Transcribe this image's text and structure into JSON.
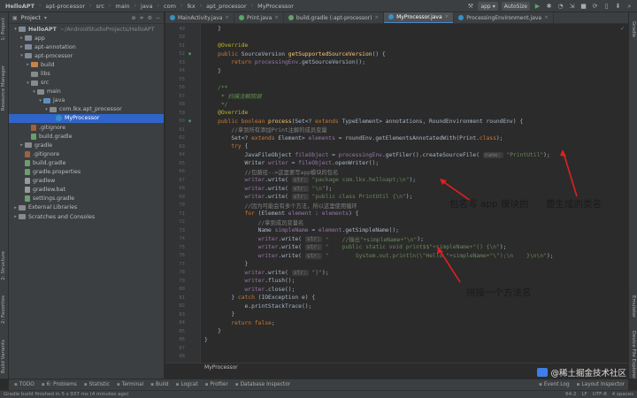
{
  "topbar": {
    "crumbs": [
      "HelloAPT",
      "apt-processor",
      "src",
      "main",
      "java",
      "com",
      "lkx",
      "apt_processor",
      "MyProcessor"
    ],
    "run_config": "app",
    "sync": "AutoSize"
  },
  "left_strip": {
    "labels": [
      "1: Project",
      "Resource Manager",
      "2: Structure",
      "2: Favorites",
      "Build Variants"
    ]
  },
  "right_strip": {
    "labels": [
      "Gradle",
      "Emulator",
      "Device File Explorer"
    ]
  },
  "project": {
    "title": "Project",
    "tree": [
      {
        "label": "HelloAPT",
        "extra": "~/AndroidStudioProjects/HelloAPT",
        "depth": 0,
        "kind": "module",
        "arrow": "▾"
      },
      {
        "label": "app",
        "depth": 1,
        "kind": "module",
        "arrow": "▸"
      },
      {
        "label": "apt-annotation",
        "depth": 1,
        "kind": "module",
        "arrow": "▸"
      },
      {
        "label": "apt-processor",
        "depth": 1,
        "kind": "module",
        "arrow": "▾"
      },
      {
        "label": "build",
        "depth": 2,
        "kind": "orange",
        "arrow": "▸"
      },
      {
        "label": "libs",
        "depth": 2,
        "kind": "gray",
        "arrow": ""
      },
      {
        "label": "src",
        "depth": 2,
        "kind": "gray",
        "arrow": "▾"
      },
      {
        "label": "main",
        "depth": 3,
        "kind": "gray",
        "arrow": "▾"
      },
      {
        "label": "java",
        "depth": 4,
        "kind": "blue",
        "arrow": "▾"
      },
      {
        "label": "com.lkx.apt_processor",
        "depth": 5,
        "kind": "gray",
        "arrow": "▾"
      },
      {
        "label": "MyProcessor",
        "depth": 6,
        "kind": "class",
        "arrow": "",
        "selected": true
      },
      {
        "label": ".gitignore",
        "depth": 2,
        "kind": "git",
        "arrow": ""
      },
      {
        "label": "build.gradle",
        "depth": 2,
        "kind": "gradle",
        "arrow": ""
      },
      {
        "label": "gradle",
        "depth": 1,
        "kind": "gray",
        "arrow": "▸"
      },
      {
        "label": ".gitignore",
        "depth": 1,
        "kind": "git",
        "arrow": ""
      },
      {
        "label": "build.gradle",
        "depth": 1,
        "kind": "gradle",
        "arrow": ""
      },
      {
        "label": "gradle.properties",
        "depth": 1,
        "kind": "gradle",
        "arrow": ""
      },
      {
        "label": "gradlew",
        "depth": 1,
        "kind": "txt",
        "arrow": ""
      },
      {
        "label": "gradlew.bat",
        "depth": 1,
        "kind": "txt",
        "arrow": ""
      },
      {
        "label": "settings.gradle",
        "depth": 1,
        "kind": "gradle",
        "arrow": ""
      },
      {
        "label": "External Libraries",
        "depth": 0,
        "kind": "gray",
        "arrow": "▸"
      },
      {
        "label": "Scratches and Consoles",
        "depth": 0,
        "kind": "gray",
        "arrow": "▸"
      }
    ]
  },
  "tabs": [
    {
      "label": "MainActivity.java",
      "color": "#3592c4",
      "active": false
    },
    {
      "label": "Print.java",
      "color": "#59a869",
      "active": false
    },
    {
      "label": "build.gradle (:apt-processor)",
      "color": "#6b9e6e",
      "active": false
    },
    {
      "label": "MyProcessor.java",
      "color": "#3592c4",
      "active": true
    },
    {
      "label": "ProcessingEnvironment.java",
      "color": "#3592c4",
      "active": false
    }
  ],
  "editor": {
    "line_numbers": [
      "49",
      "50",
      "51",
      "52",
      "53",
      "54",
      "55",
      "56",
      "57",
      "58",
      "59",
      "60",
      "61",
      "62",
      "63",
      "64",
      "65",
      "66",
      "67",
      "68",
      "69",
      "70",
      "71",
      "72",
      "73",
      "74",
      "75",
      "76",
      "77",
      "78",
      "79",
      "80",
      "81",
      "82",
      "83",
      "84",
      "85",
      "86",
      "87",
      "88",
      "89",
      "90"
    ],
    "check_mark": "✓",
    "bottom_breadcrumb": "MyProcessor"
  },
  "annotations": {
    "package_note": "包名写 app 模块的",
    "class_note": "要生成的类名",
    "method_note": "拼接一个方法名"
  },
  "toolwindows": {
    "left": [
      "TODO",
      "6: Problems",
      "Statistic",
      "Terminal",
      "Build",
      "Logcat",
      "Profiler",
      "Database Inspector"
    ],
    "right": [
      "Event Log",
      "Layout Inspector"
    ]
  },
  "status": {
    "message": "Gradle build finished in 5 s 937 ms (4 minutes ago)",
    "position": "64:2",
    "line_sep": "LF",
    "encoding": "UTF-8",
    "indent": "4 spaces"
  },
  "watermark": {
    "text": "@稀土掘金技术社区"
  }
}
